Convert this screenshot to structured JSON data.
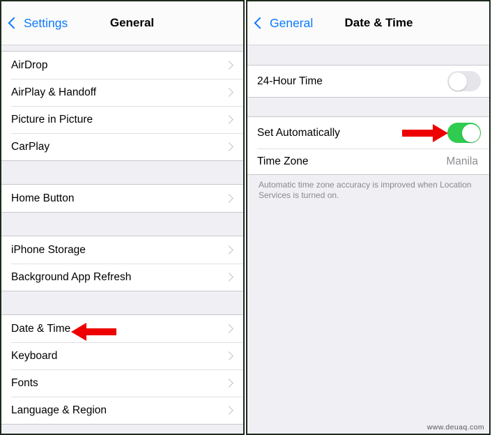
{
  "left_panel": {
    "navbar": {
      "back_label": "Settings",
      "title": "General",
      "back_icon": "chevron-left-icon",
      "accent_color": "#0a7aff"
    },
    "groups": [
      {
        "rows": [
          {
            "label": "AirDrop",
            "accessory": "chevron-right-icon"
          },
          {
            "label": "AirPlay & Handoff",
            "accessory": "chevron-right-icon"
          },
          {
            "label": "Picture in Picture",
            "accessory": "chevron-right-icon"
          },
          {
            "label": "CarPlay",
            "accessory": "chevron-right-icon"
          }
        ]
      },
      {
        "rows": [
          {
            "label": "Home Button",
            "accessory": "chevron-right-icon"
          }
        ]
      },
      {
        "rows": [
          {
            "label": "iPhone Storage",
            "accessory": "chevron-right-icon"
          },
          {
            "label": "Background App Refresh",
            "accessory": "chevron-right-icon"
          }
        ]
      },
      {
        "rows": [
          {
            "label": "Date & Time",
            "accessory": "chevron-right-icon"
          },
          {
            "label": "Keyboard",
            "accessory": "chevron-right-icon"
          },
          {
            "label": "Fonts",
            "accessory": "chevron-right-icon"
          },
          {
            "label": "Language & Region",
            "accessory": "chevron-right-icon"
          }
        ]
      }
    ],
    "annotation": {
      "icon": "red-arrow-left-icon",
      "color": "#ee0000",
      "points_at": "Date & Time"
    }
  },
  "right_panel": {
    "navbar": {
      "back_label": "General",
      "title": "Date & Time",
      "back_icon": "chevron-left-icon",
      "accent_color": "#0a7aff"
    },
    "rows": {
      "hour24_label": "24-Hour Time",
      "hour24_state": "off",
      "set_auto_label": "Set Automatically",
      "set_auto_state": "on",
      "time_zone_label": "Time Zone",
      "time_zone_value": "Manila"
    },
    "footer_note": "Automatic time zone accuracy is improved when Location Services is turned on.",
    "annotation": {
      "icon": "red-arrow-right-icon",
      "color": "#ee0000",
      "points_at": "Set Automatically toggle"
    },
    "toggle_colors": {
      "on": "#2fcc4f",
      "off": "#e5e5ea"
    }
  },
  "watermark": "www.deuaq.com"
}
